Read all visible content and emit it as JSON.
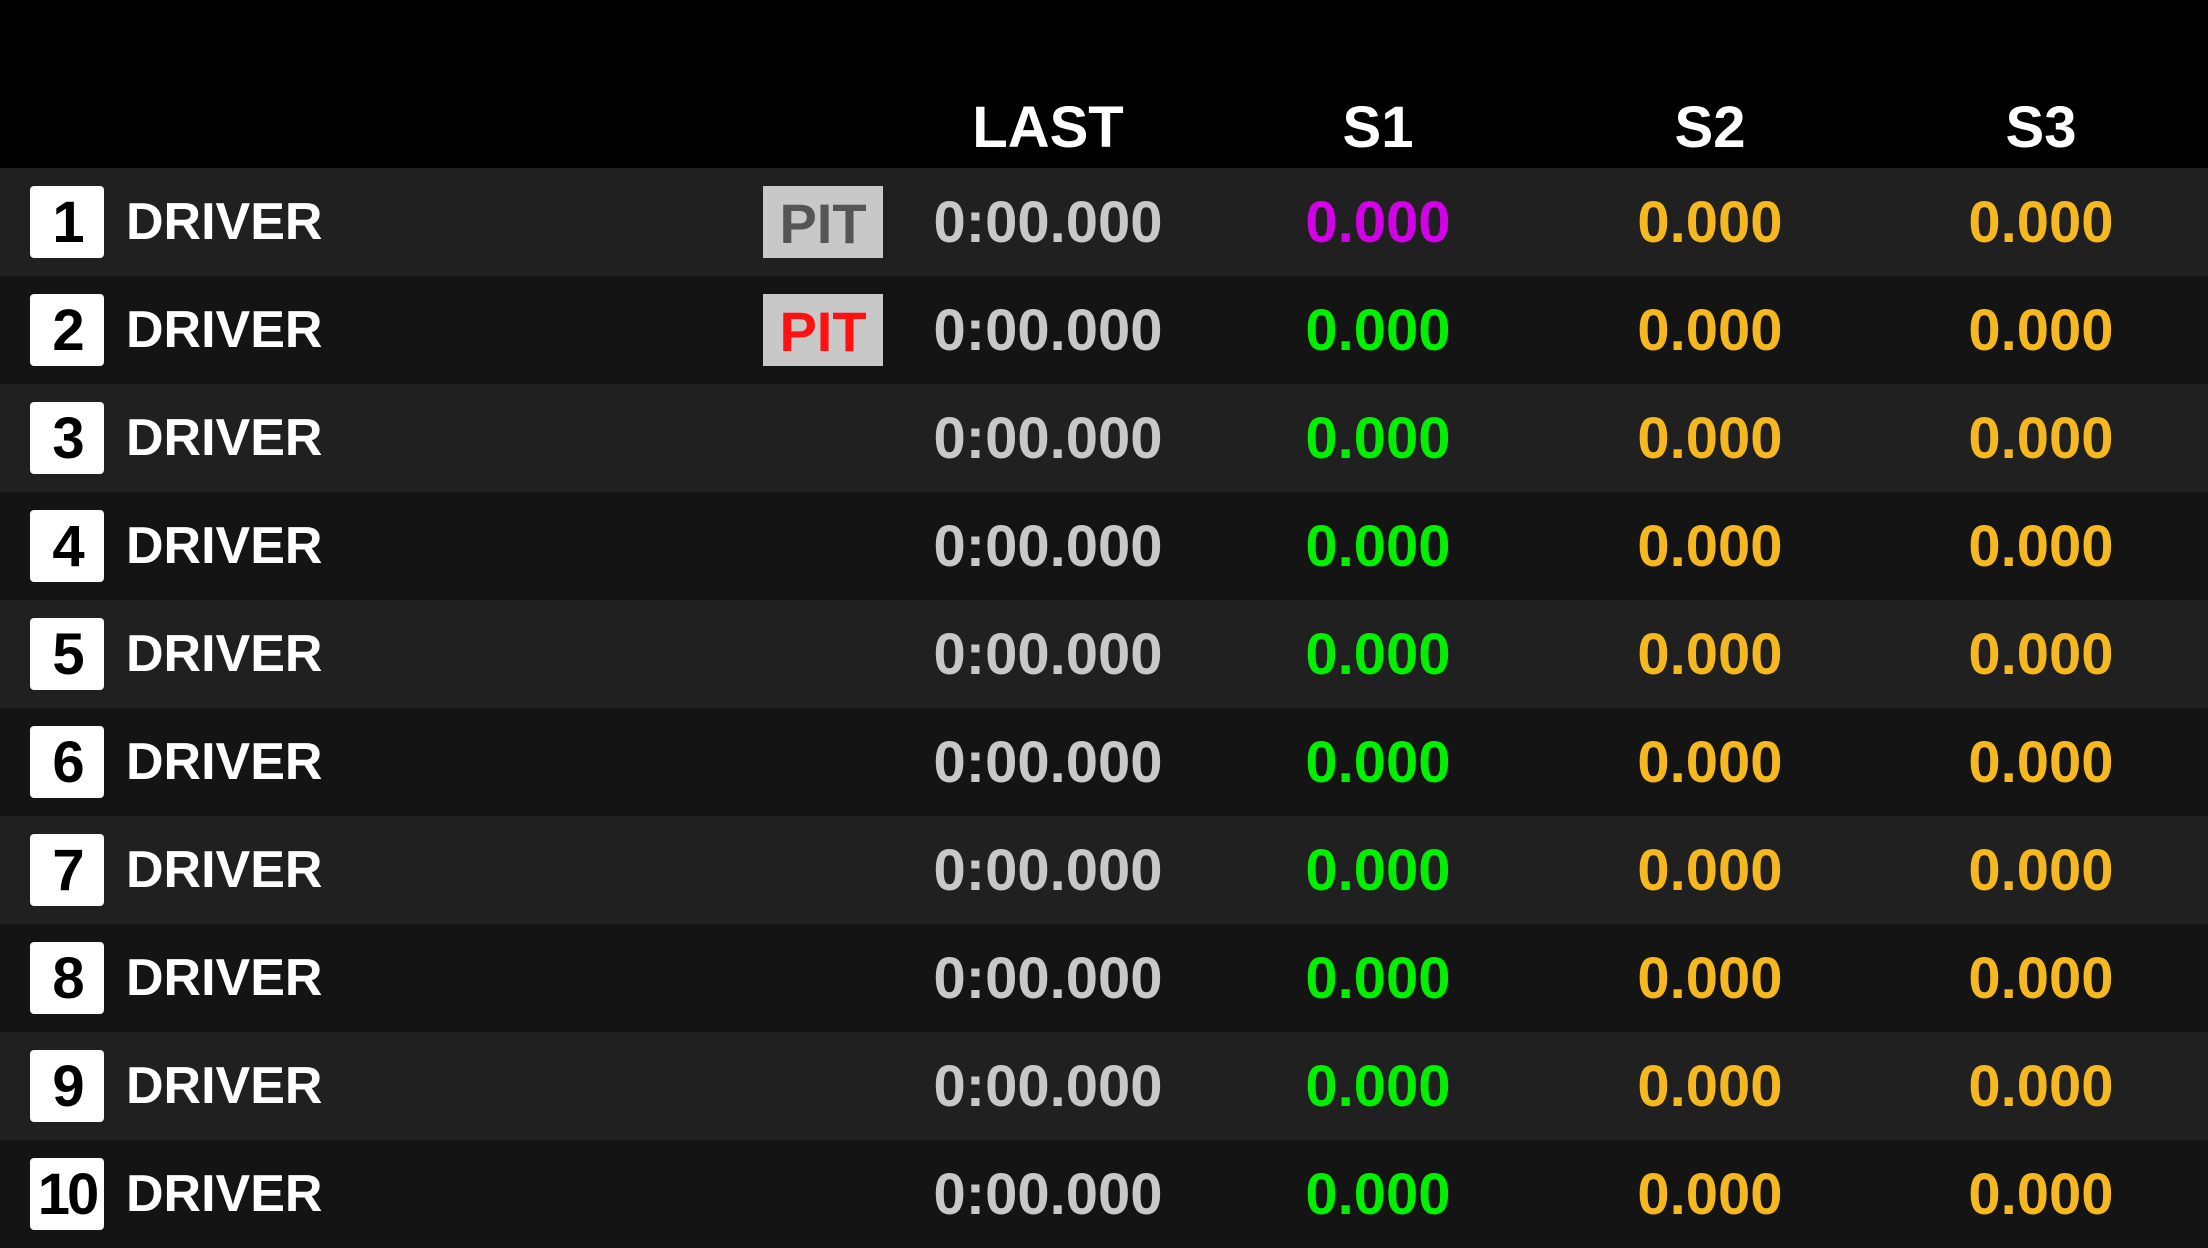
{
  "columns": {
    "last": "LAST",
    "s1": "S1",
    "s2": "S2",
    "s3": "S3"
  },
  "colors": {
    "s1_purple": "#d200e6",
    "s1_green": "#00f000",
    "sector_yellow": "#f5b820",
    "last_gray": "#c8c8c8",
    "pit_gray": "#555555",
    "pit_red": "#ff1111"
  },
  "rows": [
    {
      "pos": "1",
      "driver": "DRIVER",
      "pit": "PIT",
      "pit_style": "gray",
      "last": "0:00.000",
      "s1": "0.000",
      "s1_status": "purple",
      "s2": "0.000",
      "s3": "0.000"
    },
    {
      "pos": "2",
      "driver": "DRIVER",
      "pit": "PIT",
      "pit_style": "red",
      "last": "0:00.000",
      "s1": "0.000",
      "s1_status": "green",
      "s2": "0.000",
      "s3": "0.000"
    },
    {
      "pos": "3",
      "driver": "DRIVER",
      "pit": "",
      "pit_style": "none",
      "last": "0:00.000",
      "s1": "0.000",
      "s1_status": "green",
      "s2": "0.000",
      "s3": "0.000"
    },
    {
      "pos": "4",
      "driver": "DRIVER",
      "pit": "",
      "pit_style": "none",
      "last": "0:00.000",
      "s1": "0.000",
      "s1_status": "green",
      "s2": "0.000",
      "s3": "0.000"
    },
    {
      "pos": "5",
      "driver": "DRIVER",
      "pit": "",
      "pit_style": "none",
      "last": "0:00.000",
      "s1": "0.000",
      "s1_status": "green",
      "s2": "0.000",
      "s3": "0.000"
    },
    {
      "pos": "6",
      "driver": "DRIVER",
      "pit": "",
      "pit_style": "none",
      "last": "0:00.000",
      "s1": "0.000",
      "s1_status": "green",
      "s2": "0.000",
      "s3": "0.000"
    },
    {
      "pos": "7",
      "driver": "DRIVER",
      "pit": "",
      "pit_style": "none",
      "last": "0:00.000",
      "s1": "0.000",
      "s1_status": "green",
      "s2": "0.000",
      "s3": "0.000"
    },
    {
      "pos": "8",
      "driver": "DRIVER",
      "pit": "",
      "pit_style": "none",
      "last": "0:00.000",
      "s1": "0.000",
      "s1_status": "green",
      "s2": "0.000",
      "s3": "0.000"
    },
    {
      "pos": "9",
      "driver": "DRIVER",
      "pit": "",
      "pit_style": "none",
      "last": "0:00.000",
      "s1": "0.000",
      "s1_status": "green",
      "s2": "0.000",
      "s3": "0.000"
    },
    {
      "pos": "10",
      "driver": "DRIVER",
      "pit": "",
      "pit_style": "none",
      "last": "0:00.000",
      "s1": "0.000",
      "s1_status": "green",
      "s2": "0.000",
      "s3": "0.000"
    }
  ]
}
